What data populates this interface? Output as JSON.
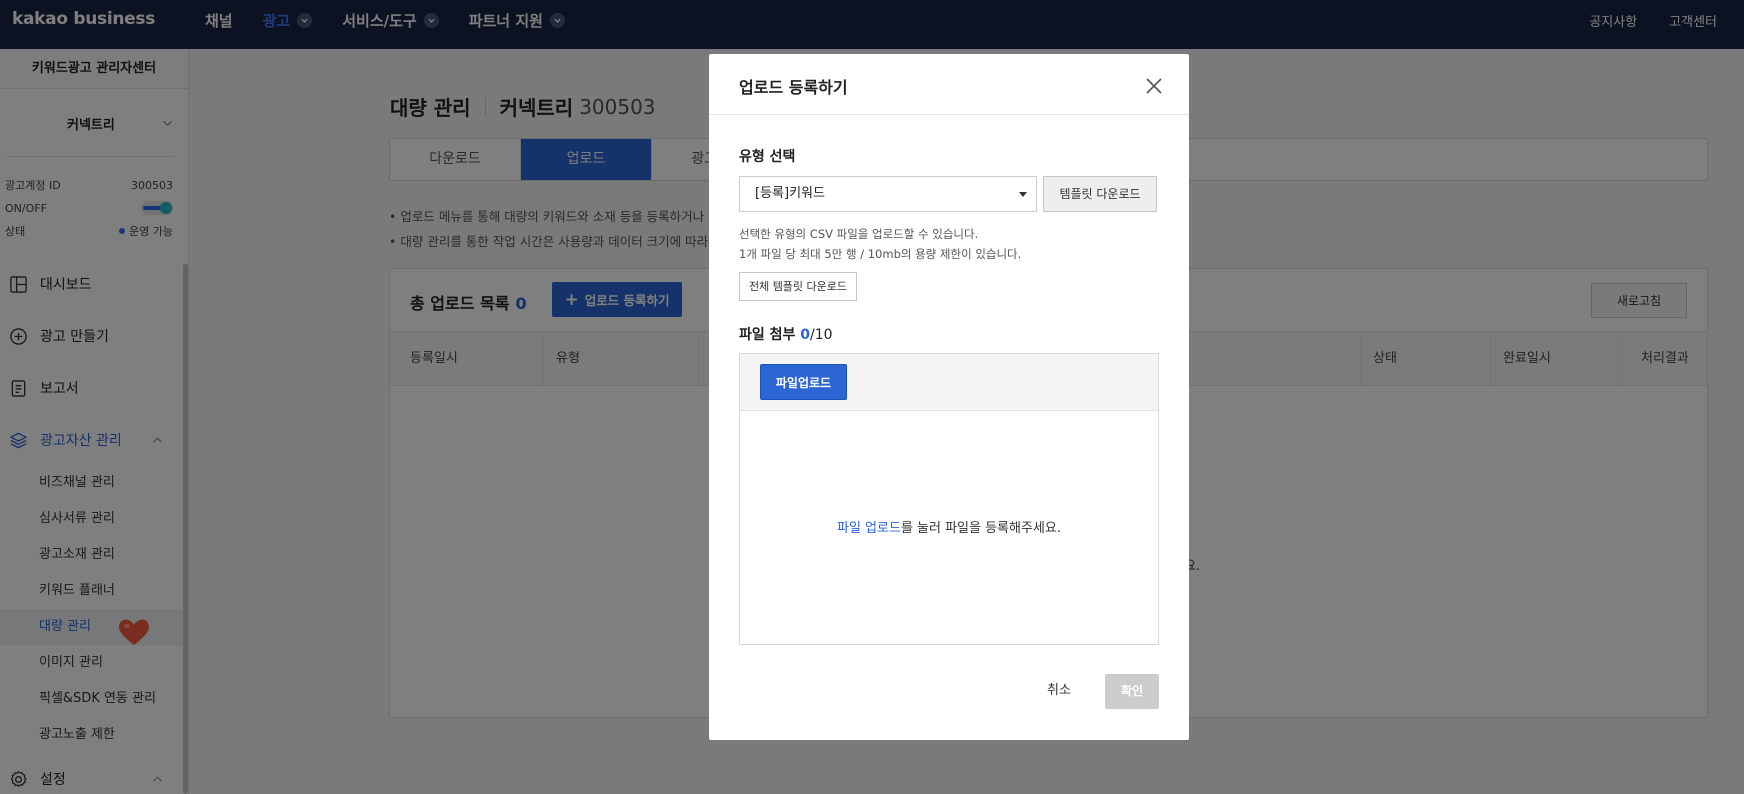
{
  "topbar": {
    "logo": "kakao business",
    "nav": [
      {
        "label": "채널",
        "active": false,
        "dropdown": false
      },
      {
        "label": "광고",
        "active": true,
        "dropdown": true
      },
      {
        "label": "서비스/도구",
        "active": false,
        "dropdown": true
      },
      {
        "label": "파트너 지원",
        "active": false,
        "dropdown": true
      }
    ],
    "notice": "공지사항",
    "support": "고객센터"
  },
  "sidebar": {
    "title": "키워드광고 관리자센터",
    "account_name": "커넥트리",
    "info": {
      "id_label": "광고계정 ID",
      "id_value": "300503",
      "onoff_label": "ON/OFF",
      "onoff_state": true,
      "status_label": "상태",
      "status_value": "운영 가능"
    },
    "menu": {
      "dashboard": "대시보드",
      "create_ad": "광고 만들기",
      "report": "보고서",
      "assets": "광고자산 관리",
      "settings": "설정"
    },
    "sub_items": [
      "비즈채널 관리",
      "심사서류 관리",
      "광고소재 관리",
      "키워드 플래너",
      "대량 관리",
      "이미지 관리",
      "픽셀&SDK 연동 관리",
      "광고노출 제한"
    ],
    "active_sub": "대량 관리"
  },
  "main": {
    "title": "대량 관리",
    "account": "커넥트리",
    "account_id": "300503",
    "tabs": [
      {
        "label": "다운로드",
        "active": false
      },
      {
        "label": "업로드",
        "active": true
      },
      {
        "label": "광고그룹",
        "active": false
      }
    ],
    "notes": [
      "• 업로드 메뉴를 통해 대량의 키워드와 소재 등을 등록하거나",
      "• 대량 관리를 통한 작업 시간은 사용량과 데이터 크기에 따라"
    ],
    "list_title": "총 업로드 목록",
    "list_count": "0",
    "register_button": "업로드 등록하기",
    "refresh_button": "새로고침",
    "columns": [
      "등록일시",
      "유형",
      "상태",
      "완료일시",
      "처리결과"
    ],
    "empty_fragment": "하세요."
  },
  "modal": {
    "title": "업로드 등록하기",
    "type_label": "유형 선택",
    "selected_type": "[등록]키워드",
    "template_button": "템플릿 다운로드",
    "help_lines": [
      "선택한 유형의 CSV 파일을 업로드할 수 있습니다.",
      "1개 파일 당 최대 5만 행 / 10mb의 용량 제한이 있습니다."
    ],
    "all_template_button": "전체 템플릿 다운로드",
    "attach_label": "파일 첨부",
    "attach_count": "0",
    "attach_max": "/10",
    "file_upload_button": "파일업로드",
    "drop_link": "파일 업로드",
    "drop_text": "를 눌러 파일을 등록해주세요.",
    "cancel": "취소",
    "confirm": "확인"
  }
}
